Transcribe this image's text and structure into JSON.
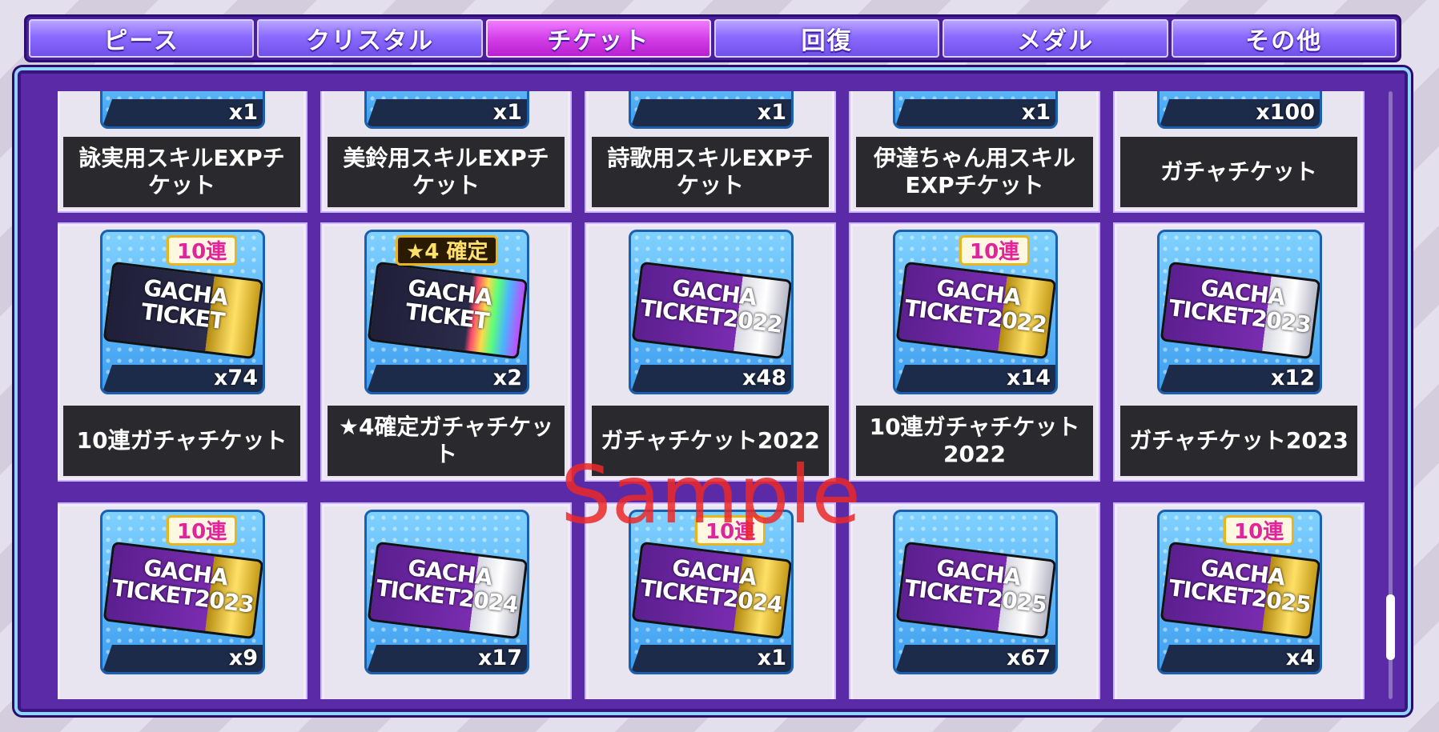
{
  "tabs": [
    {
      "label": "ピース",
      "active": false
    },
    {
      "label": "クリスタル",
      "active": false
    },
    {
      "label": "チケット",
      "active": true
    },
    {
      "label": "回復",
      "active": false
    },
    {
      "label": "メダル",
      "active": false
    },
    {
      "label": "その他",
      "active": false
    }
  ],
  "items": {
    "row1": [
      {
        "qty": "x1",
        "name": "詠実用スキルEXPチケット"
      },
      {
        "qty": "x1",
        "name": "美鈴用スキルEXPチケット"
      },
      {
        "qty": "x1",
        "name": "詩歌用スキルEXPチケット"
      },
      {
        "qty": "x1",
        "name": "伊達ちゃん用スキルEXPチケット"
      },
      {
        "qty": "x100",
        "name": "ガチャチケット"
      }
    ],
    "row2": [
      {
        "qty": "x74",
        "name": "10連ガチャチケット",
        "badge": "10連",
        "ticket": "GACHA TICKET"
      },
      {
        "qty": "x2",
        "name": "★4確定ガチャチケット",
        "badge": "★4 確定",
        "ticket": "GACHA TICKET"
      },
      {
        "qty": "x48",
        "name": "ガチャチケット2022",
        "ticket": "GACHA TICKET2022"
      },
      {
        "qty": "x14",
        "name": "10連ガチャチケット 2022",
        "badge": "10連",
        "ticket": "GACHA TICKET2022"
      },
      {
        "qty": "x12",
        "name": "ガチャチケット2023",
        "ticket": "GACHA TICKET2023"
      }
    ],
    "row3": [
      {
        "qty": "x9",
        "badge": "10連",
        "ticket": "GACHA TICKET2023"
      },
      {
        "qty": "x17",
        "ticket": "GACHA TICKET2024"
      },
      {
        "qty": "x1",
        "badge": "10連",
        "ticket": "GACHA TICKET2024"
      },
      {
        "qty": "x67",
        "ticket": "GACHA TICKET2025"
      },
      {
        "qty": "x4",
        "badge": "10連",
        "ticket": "GACHA TICKET2025"
      }
    ]
  },
  "watermark": "Sample"
}
